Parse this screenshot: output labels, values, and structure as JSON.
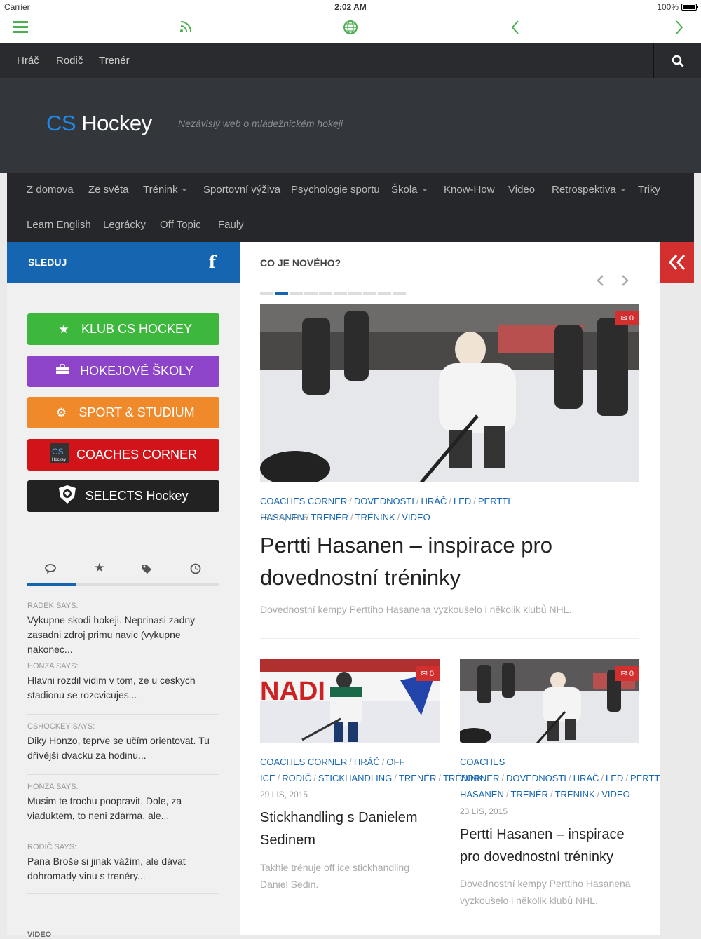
{
  "status": {
    "carrier": "Carrier",
    "time": "2:02 AM",
    "battery": "100%"
  },
  "topnav": {
    "items": [
      "Hráč",
      "Rodič",
      "Trenér"
    ]
  },
  "site": {
    "logo_cs": "CS",
    "logo_rest": "Hockey",
    "tagline": "Nezávislý web o mládežnickém hokeji"
  },
  "mainnav": {
    "row1": [
      "Z domova",
      "Ze světa",
      "Trénink",
      "Sportovní výživa",
      "Psychologie sportu",
      "Škola",
      "Know-How",
      "Video",
      "Retrospektiva",
      "Triky"
    ],
    "row2": [
      "Learn English",
      "Legrácky",
      "Off Topic",
      "Fauly"
    ]
  },
  "sidebar": {
    "heading": "SLEDUJ",
    "buttons": [
      {
        "label": "KLUB CS HOCKEY",
        "color": "#3db83d"
      },
      {
        "label": "HOKEJOVÉ ŠKOLY",
        "color": "#8e44c8"
      },
      {
        "label": "SPORT & STUDIUM",
        "color": "#f0892a"
      },
      {
        "label": "COACHES CORNER",
        "color": "#d0141a"
      },
      {
        "label": "SELECTS Hockey",
        "color": "#222222"
      }
    ],
    "comments": [
      {
        "who": "RADEK SAYS:",
        "text": "Vykupne skodi hokeji. Neprinasi zadny zasadni zdroj primu navic (vykupne nakonec..."
      },
      {
        "who": "HONZA SAYS:",
        "text": "Hlavni rozdil vidim v tom, ze u ceskych stadionu se rozcvicujes..."
      },
      {
        "who": "CSHOCKEY SAYS:",
        "text": "Diky Honzo, tepr​ve se učím orientovat. Tu dřívější dvacku za hodinu..."
      },
      {
        "who": "HONZA SAYS:",
        "text": "Musim te trochu poopravit. Dole, za viaduktem, to neni zdarma, ale..."
      },
      {
        "who": "RODIČ SAYS:",
        "text": "Pana Broše si jinak vážím, ale dávat dohromady vinu s trenéry..."
      }
    ],
    "bottom_label": "VIDEO"
  },
  "content": {
    "heading": "CO JE NOVÉHO?",
    "featured": {
      "comments": "0",
      "tags": [
        "COACHES CORNER",
        "DOVEDNOSTI",
        "HRÁČ",
        "LED",
        "PERTTI HASANEN",
        "TRENÉR",
        "TRÉNINK",
        "VIDEO"
      ],
      "date": "23 LIS, 2015",
      "title": "Pertti Hasanen – inspirace pro dovednostní tréninky",
      "excerpt": "Dovednostní kempy Perttiho Hasanena vyzkoušelo i několik klubů NHL."
    },
    "cards": [
      {
        "comments": "0",
        "tags": [
          "COACHES CORNER",
          "HRÁČ",
          "OFF ICE",
          "RODIČ",
          "STICKHANDLING",
          "TRENÉR",
          "TRÉNINK"
        ],
        "date": "29 LIS, 2015",
        "title": "Stickhandling s Danielem Sedinem",
        "excerpt": "Takhle trénuje off ice stickhandling Daniel Sedin."
      },
      {
        "comments": "0",
        "tags": [
          "COACHES CORNER",
          "DOVEDNOSTI",
          "HRÁČ",
          "LED",
          "PERTTI HASANEN",
          "TRENÉR",
          "TRÉNINK",
          "VIDEO"
        ],
        "date": "23 LIS, 2015",
        "title": "Pertti Hasanen – inspirace pro dovednostní tréninky",
        "excerpt": "Dovednostní kempy Perttiho Hasanena vyzkoušelo i několik klubů NHL."
      }
    ]
  }
}
